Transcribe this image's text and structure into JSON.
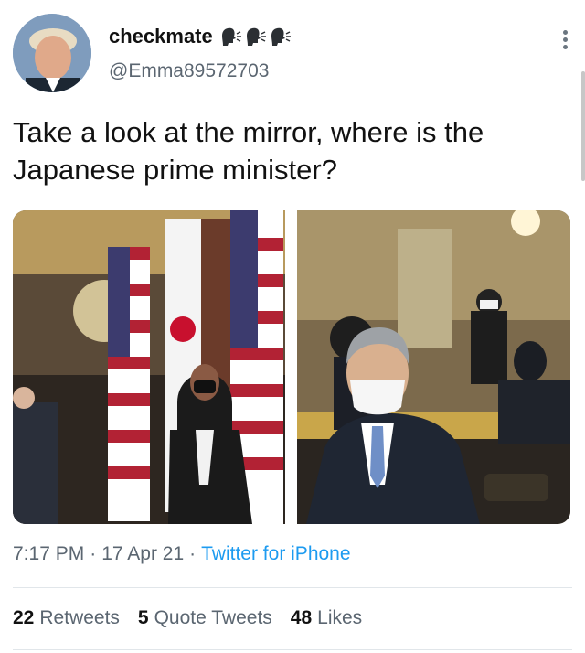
{
  "header": {
    "display_name": "checkmate",
    "handle": "@Emma89572703",
    "emojis": [
      "speaking-head-icon",
      "speaking-head-icon",
      "speaking-head-icon"
    ]
  },
  "tweet": {
    "text": "Take a look at the mirror, where is the Japanese prime minister?"
  },
  "meta": {
    "time": "7:17 PM",
    "date": "17 Apr 21",
    "separator": "·",
    "source": "Twitter for iPhone"
  },
  "stats": {
    "retweets_count": "22",
    "retweets_label": "Retweets",
    "quotes_count": "5",
    "quotes_label": "Quote Tweets",
    "likes_count": "48",
    "likes_label": "Likes"
  },
  "colors": {
    "link": "#1d9bf0",
    "secondary_text": "#5b6671"
  }
}
